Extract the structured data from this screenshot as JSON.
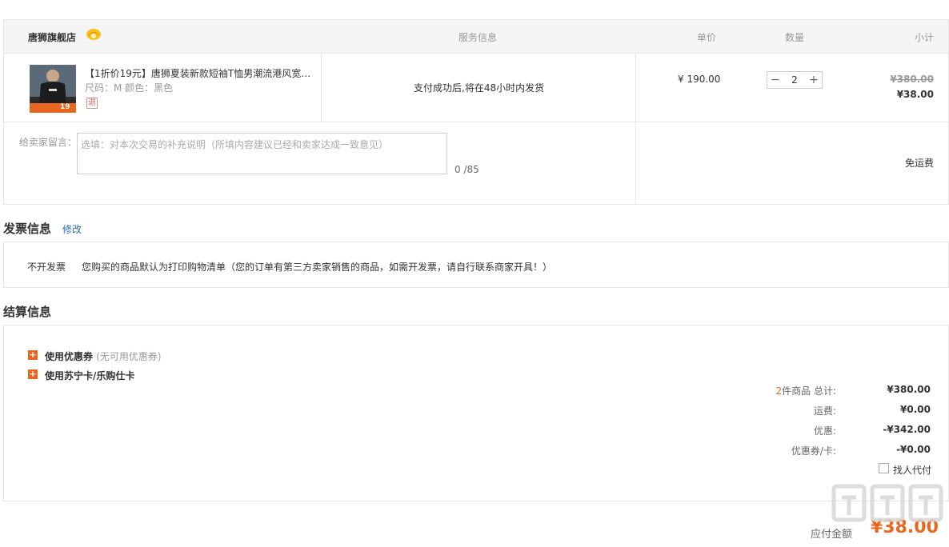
{
  "order": {
    "store_name": "唐狮旗舰店",
    "headers": {
      "service": "服务信息",
      "price": "单价",
      "qty": "数量",
      "subtotal": "小计"
    },
    "item": {
      "title": "【1折价19元】唐狮夏装新款短袖T恤男潮流港风宽…",
      "spec": "尺码：M   颜色：黑色",
      "refund_tag": "退",
      "thumb_badge": "19",
      "service_text": "支付成功后,将在48小时内发货",
      "price": "¥ 190.00",
      "qty": "2",
      "qty_minus": "−",
      "qty_plus": "+",
      "subtotal_old": "¥380.00",
      "subtotal_new": "¥38.00"
    },
    "message": {
      "label": "给卖家留言：",
      "placeholder": "选填：对本次交易的补充说明（所填内容建议已经和卖家达成一致意见）",
      "count": "0 /85"
    },
    "shipping": "免运费"
  },
  "invoice": {
    "title": "发票信息",
    "edit_link": "修改",
    "type": "不开发票",
    "note": "您购买的商品默认为打印购物清单（您的订单有第三方卖家销售的商品，如需开发票，请自行联系商家开具！）"
  },
  "settlement": {
    "title": "结算信息",
    "coupon_label": "使用优惠券",
    "coupon_sub": "(无可用优惠券)",
    "card_label": "使用苏宁卡/乐购仕卡",
    "summary": {
      "count": "2",
      "count_suffix": "件商品 总计:",
      "total": "¥380.00",
      "shipping_label": "运费:",
      "shipping": "¥0.00",
      "discount_label": "优惠:",
      "discount": "-¥342.00",
      "coupon_card_label": "优惠券/卡:",
      "coupon_card": "-¥0.00"
    },
    "proxy_pay": "找人代付",
    "pay_label": "应付金额",
    "pay_amount": "¥38.00"
  },
  "colors": {
    "accent": "#e8661e",
    "link": "#2a6eb8",
    "border": "#e6e6e6"
  }
}
